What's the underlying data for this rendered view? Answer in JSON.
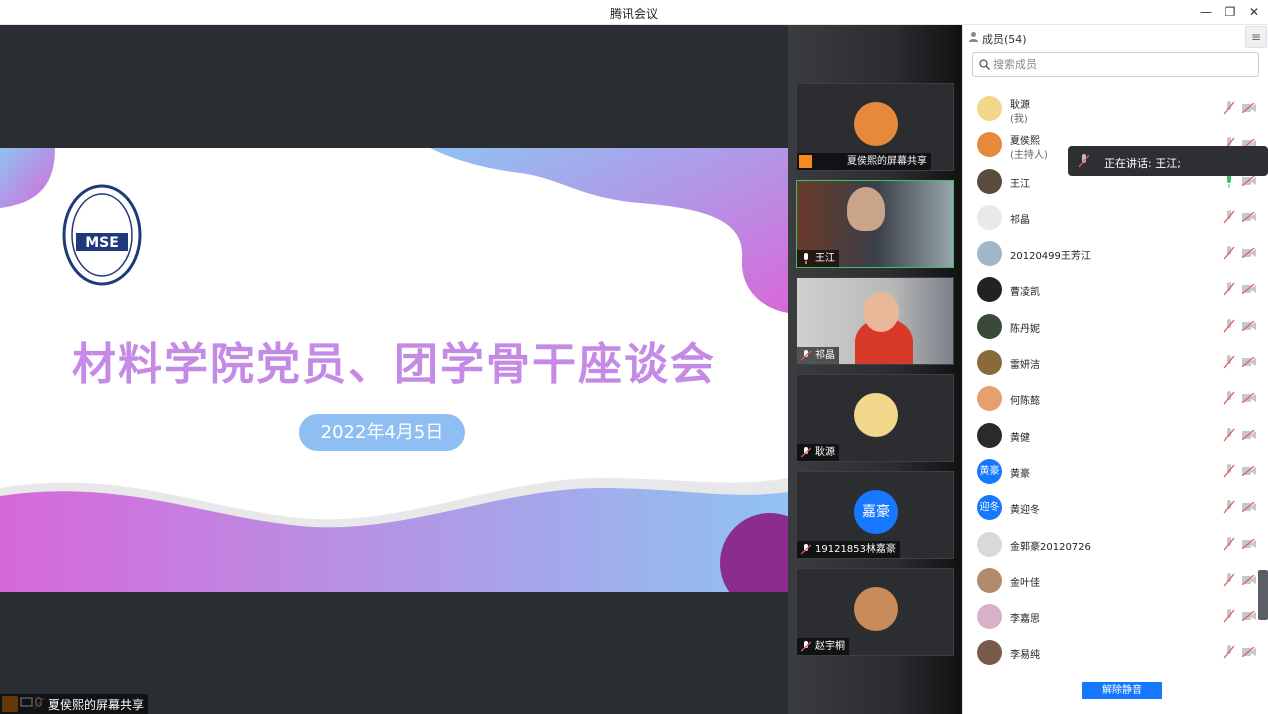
{
  "window": {
    "title": "腾讯会议",
    "minimize": "—",
    "restore": "❐",
    "close": "✕"
  },
  "slide": {
    "title": "材料学院党员、团学骨干座谈会",
    "date": "2022年4月5日",
    "logo_text": "MSE"
  },
  "share_label": "夏侯熙的屏幕共享",
  "thumbnails": [
    {
      "label": "夏侯熙的屏幕共享",
      "avatar_color": "#e6893a"
    },
    {
      "label": "王江",
      "avatar_color": "#5a4c3c"
    },
    {
      "label": "祁晶",
      "avatar_color": "#d64b3a"
    },
    {
      "label": "耿源",
      "avatar_color": "#f2d68a"
    },
    {
      "label": "19121853林嘉豪",
      "avatar_text": "嘉豪",
      "avatar_color": "#1677ff"
    },
    {
      "label": "赵宇桐",
      "avatar_color": "#c98b5a"
    }
  ],
  "panel": {
    "title": "成员(54)",
    "menu_icon": "≡",
    "search_placeholder": "搜索成员",
    "unmute_label": "解除静音",
    "speaking": "正在讲话: 王江;"
  },
  "members": [
    {
      "name": "耿源",
      "sub": "(我)",
      "avatar_color": "#f2d68a"
    },
    {
      "name": "夏侯熙",
      "sub": "(主持人)",
      "avatar_color": "#e6893a"
    },
    {
      "name": "王江",
      "avatar_color": "#5a4c3c",
      "speaking": true
    },
    {
      "name": "祁晶",
      "avatar_color": "#e9e9e9"
    },
    {
      "name": "20120499王芳江",
      "avatar_color": "#9fb7c8"
    },
    {
      "name": "曹凌凯",
      "avatar_color": "#222222"
    },
    {
      "name": "陈丹妮",
      "avatar_color": "#3a4a3a"
    },
    {
      "name": "雷妍洁",
      "avatar_color": "#8a6a3a"
    },
    {
      "name": "何陈懿",
      "avatar_color": "#e6a070"
    },
    {
      "name": "黄健",
      "avatar_color": "#2a2a2a"
    },
    {
      "name": "黄豪",
      "avatar_text": "黄豪",
      "avatar_color": "#1677ff"
    },
    {
      "name": "黄迎冬",
      "avatar_text": "迎冬",
      "avatar_color": "#1677ff"
    },
    {
      "name": "金郭豪20120726",
      "avatar_color": "#d9d9d9"
    },
    {
      "name": "金叶佳",
      "avatar_color": "#b08a6a"
    },
    {
      "name": "李嘉思",
      "avatar_color": "#d8b0c8"
    },
    {
      "name": "李易纯",
      "avatar_color": "#7a5a4a"
    }
  ],
  "colors": {
    "accent": "#1677ff",
    "speaking_green": "#3bbf68",
    "muted_red": "#e05a5a",
    "slide_gradient_start": "#8fc3f2",
    "slide_gradient_end": "#d768d9"
  }
}
